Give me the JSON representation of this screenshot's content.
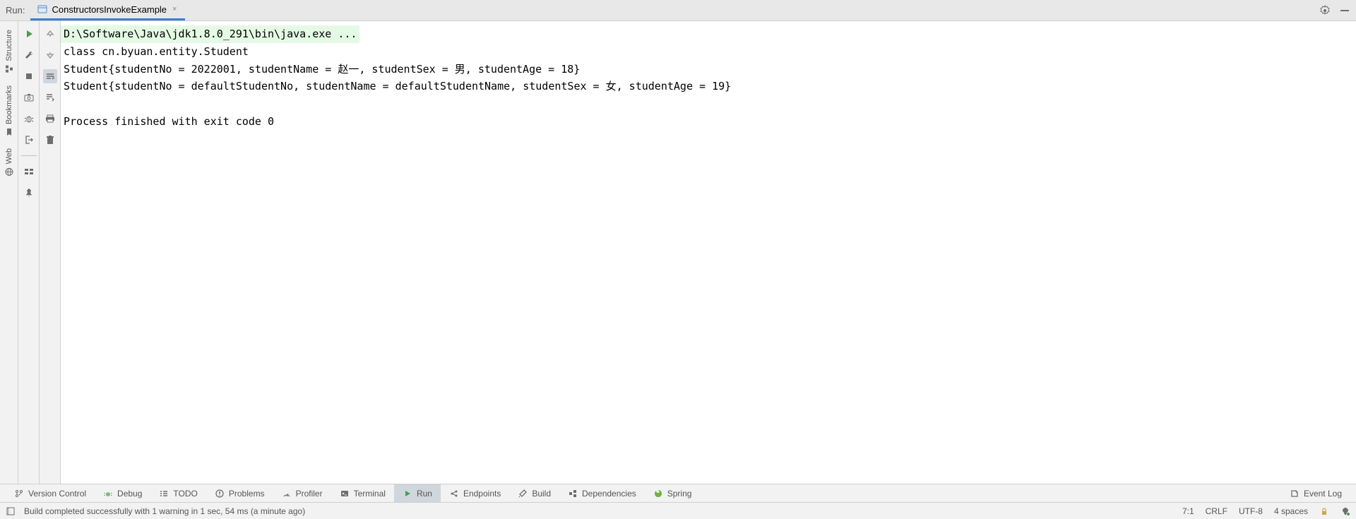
{
  "header": {
    "label": "Run:",
    "tab_label": "ConstructorsInvokeExample"
  },
  "console": {
    "cmd": "D:\\Software\\Java\\jdk1.8.0_291\\bin\\java.exe ...",
    "line1": "class cn.byuan.entity.Student",
    "line2": "Student{studentNo = 2022001, studentName = 赵一, studentSex = 男, studentAge = 18}",
    "line3": "Student{studentNo = defaultStudentNo, studentName = defaultStudentName, studentSex = 女, studentAge = 19}",
    "exit": "Process finished with exit code 0"
  },
  "left_tabs": {
    "structure": "Structure",
    "bookmarks": "Bookmarks",
    "web": "Web"
  },
  "bottom_tabs": {
    "vc": "Version Control",
    "debug": "Debug",
    "todo": "TODO",
    "problems": "Problems",
    "profiler": "Profiler",
    "terminal": "Terminal",
    "run": "Run",
    "endpoints": "Endpoints",
    "build": "Build",
    "deps": "Dependencies",
    "spring": "Spring",
    "eventlog": "Event Log"
  },
  "status": {
    "message": "Build completed successfully with 1 warning in 1 sec, 54 ms (a minute ago)",
    "pos": "7:1",
    "lineend": "CRLF",
    "encoding": "UTF-8",
    "indent": "4 spaces"
  }
}
